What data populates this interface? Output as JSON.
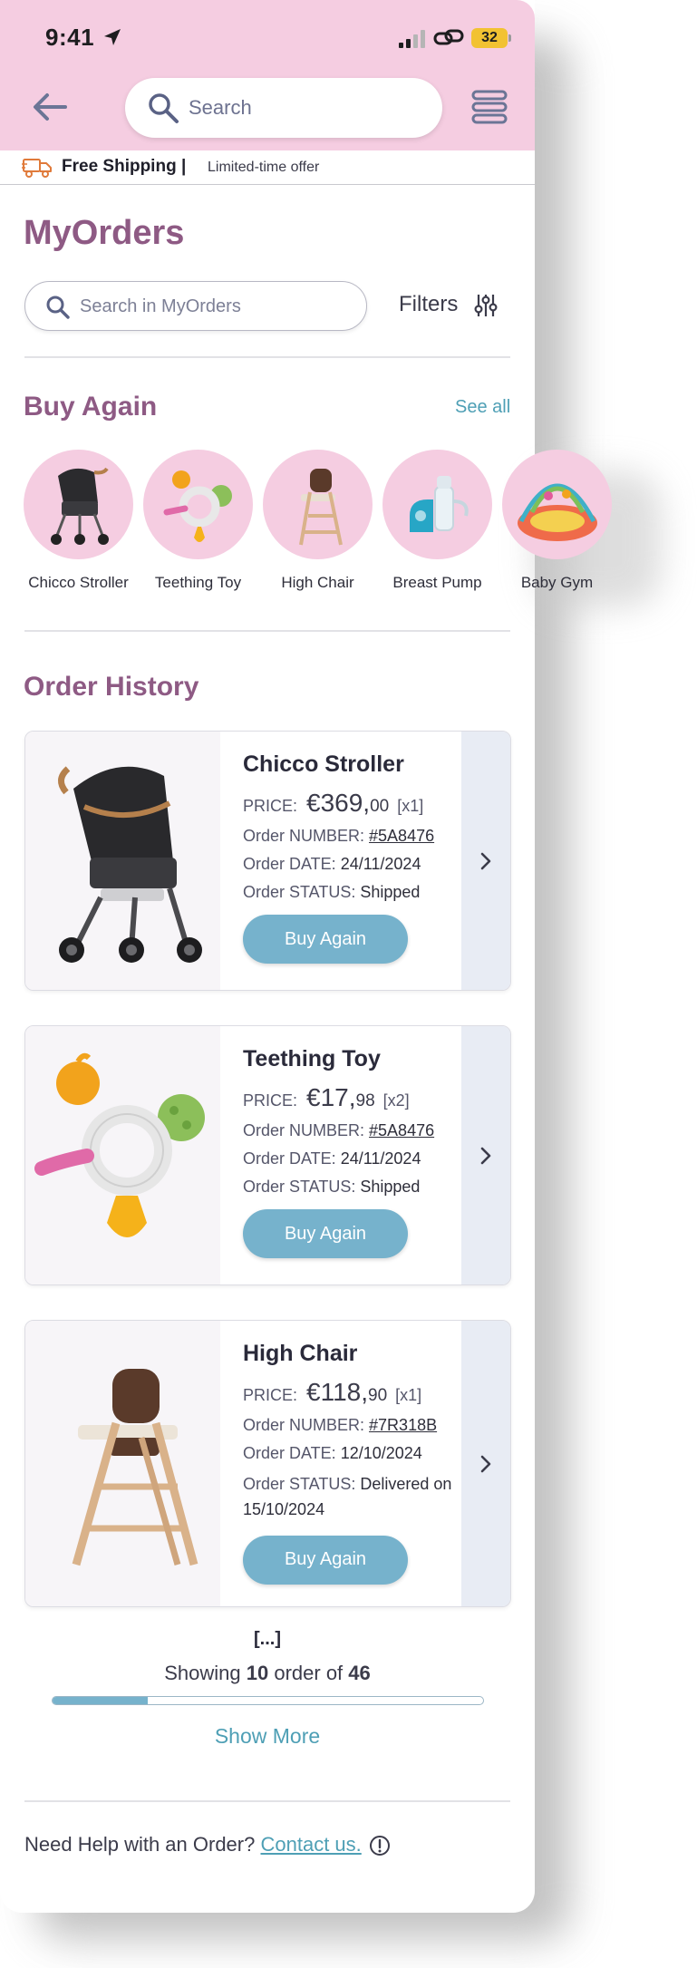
{
  "status_bar": {
    "time": "9:41",
    "battery": "32"
  },
  "header": {
    "search_placeholder": "Search"
  },
  "promo": {
    "title": "Free Shipping |",
    "subtitle": "Limited-time offer"
  },
  "page": {
    "title": "MyOrders"
  },
  "order_search": {
    "placeholder": "Search in MyOrders",
    "filters_label": "Filters"
  },
  "buy_again": {
    "title": "Buy Again",
    "see_all": "See all",
    "items": [
      {
        "label": "Chicco Stroller"
      },
      {
        "label": "Teething Toy"
      },
      {
        "label": "High Chair"
      },
      {
        "label": "Breast Pump"
      },
      {
        "label": "Baby Gym"
      }
    ]
  },
  "order_history": {
    "title": "Order History",
    "orders": [
      {
        "name": "Chicco Stroller",
        "price_label": "PRICE:",
        "price_main": "€369,",
        "price_cents": "00",
        "qty": "[x1]",
        "number_label": "Order NUMBER:",
        "number": "#5A8476",
        "date_label": "Order DATE:",
        "date": "24/11/2024",
        "status_label": "Order STATUS:",
        "status": "Shipped",
        "button": "Buy Again"
      },
      {
        "name": "Teething Toy",
        "price_label": "PRICE:",
        "price_main": "€17,",
        "price_cents": "98",
        "qty": "[x2]",
        "number_label": "Order NUMBER:",
        "number": "#5A8476",
        "date_label": "Order DATE:",
        "date": "24/11/2024",
        "status_label": "Order STATUS:",
        "status": "Shipped",
        "button": "Buy Again"
      },
      {
        "name": "High Chair",
        "price_label": "PRICE:",
        "price_main": "€118,",
        "price_cents": "90",
        "qty": "[x1]",
        "number_label": "Order NUMBER:",
        "number": "#7R318B",
        "date_label": "Order DATE:",
        "date": "12/10/2024",
        "status_label": "Order STATUS:",
        "status": "Delivered on 15/10/2024",
        "button": "Buy Again"
      }
    ]
  },
  "pagination": {
    "ellipsis": "[...]",
    "showing_prefix": "Showing",
    "shown": "10",
    "middle": "order of",
    "total": "46",
    "progress_fraction": 0.22,
    "show_more": "Show More"
  },
  "footer": {
    "help_text": "Need Help with an Order?",
    "contact": "Contact us."
  },
  "colors": {
    "brand_pink": "#f5cde1",
    "title_purple": "#8e5a84",
    "accent_blue": "#76b2cc",
    "link_blue": "#4e9fb5"
  }
}
